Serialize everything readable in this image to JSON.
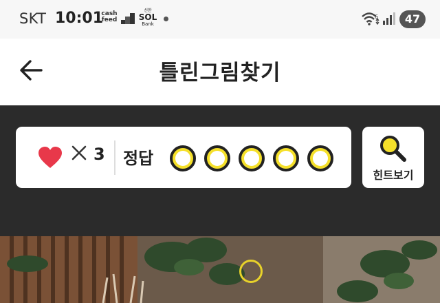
{
  "status_bar": {
    "carrier": "SKT",
    "time": "10:01",
    "cashfeed_line1": "cash",
    "cashfeed_line2": "feed",
    "sol_top": "신한",
    "sol_main": "SOL",
    "sol_bottom": "Bank",
    "wifi_badge": "6",
    "battery": "47"
  },
  "header": {
    "title": "틀린그림찾기"
  },
  "game": {
    "lives_symbol": "×",
    "lives_count": "3",
    "answer_label": "정답",
    "answer_slots": 5,
    "hint_label": "힌트보기"
  },
  "colors": {
    "panel": "#2b2b2b",
    "heart": "#e8384a",
    "circle_yellow": "#f5e02a",
    "circle_outline": "#222222"
  }
}
